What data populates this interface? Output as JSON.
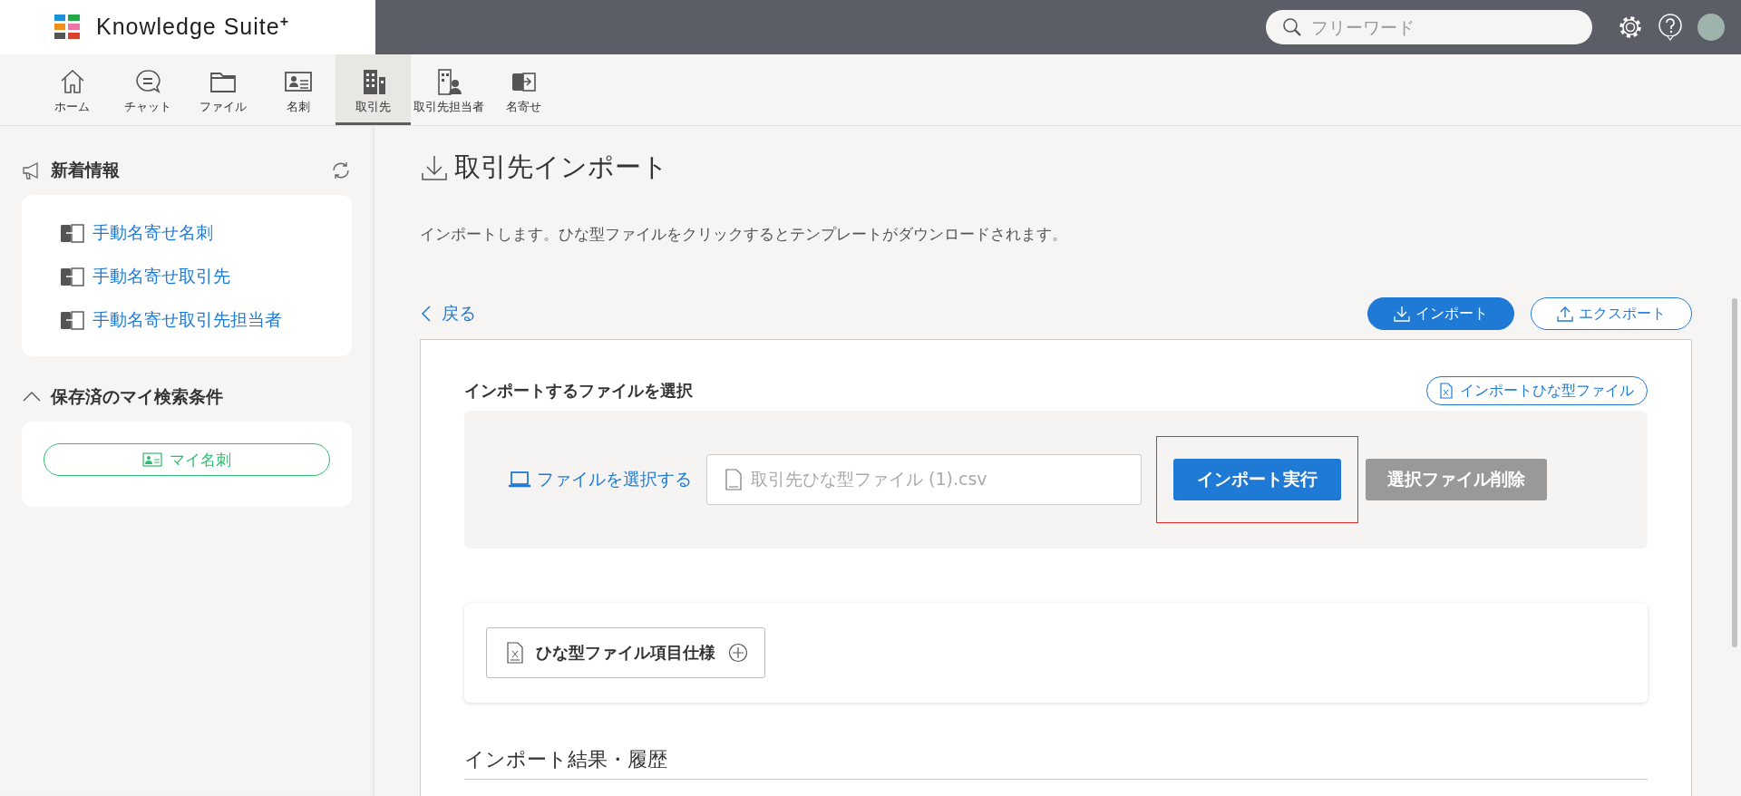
{
  "header": {
    "logo_text": "Knowledge Suite",
    "logo_sup": "+",
    "search": {
      "placeholder": "フリーワード"
    }
  },
  "nav": [
    {
      "label": "ホーム",
      "selected": false
    },
    {
      "label": "チャット",
      "selected": false
    },
    {
      "label": "ファイル",
      "selected": false
    },
    {
      "label": "名刺",
      "selected": false
    },
    {
      "label": "取引先",
      "selected": true
    },
    {
      "label": "取引先担当者",
      "selected": false
    },
    {
      "label": "名寄せ",
      "selected": false
    }
  ],
  "sidebar": {
    "news_title": "新着情報",
    "news_items": [
      "手動名寄せ名刺",
      "手動名寄せ取引先",
      "手動名寄せ取引先担当者"
    ],
    "saved_title": "保存済のマイ検索条件",
    "saved_expanded": true,
    "saved_items": [
      "マイ名刺"
    ]
  },
  "main": {
    "title": "取引先インポート",
    "description": "インポートします。ひな型ファイルをクリックするとテンプレートがダウンロードされます。",
    "back": "戻る",
    "mode_buttons": [
      {
        "label": "インポート",
        "selected": true
      },
      {
        "label": "エクスポート",
        "selected": false
      }
    ],
    "section_title": "インポートするファイルを選択",
    "template_link": "インポートひな型ファイル",
    "choose_file": "ファイルを選択する",
    "file_name": "取引先ひな型ファイル (1).csv",
    "run_button": {
      "label": "インポート実行",
      "highlighted": true
    },
    "delete_button": {
      "label": "選択ファイル削除",
      "disabled": true
    },
    "spec_button": "ひな型ファイル項目仕様",
    "history_title": "インポート結果・履歴"
  }
}
